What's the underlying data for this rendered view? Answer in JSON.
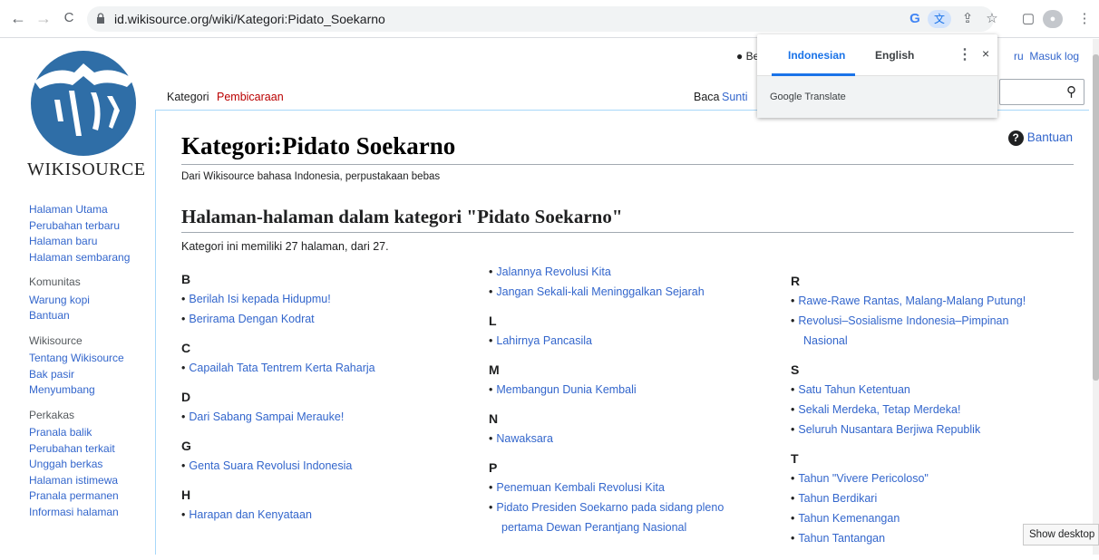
{
  "browser": {
    "url": "id.wikisource.org/wiki/Kategori:Pidato_Soekarno",
    "back_icon": "←",
    "forward_icon": "→",
    "reload_icon": "C",
    "google_icon": "G",
    "translate_icon": "文",
    "share_icon": "⇪",
    "star_icon": "☆",
    "sidepanel_icon": "▢",
    "profile_icon": "●",
    "menu_icon": "⋮"
  },
  "translate_popup": {
    "lang_source": "Indonesian",
    "lang_target": "English",
    "menu": "⋮",
    "close": "×",
    "brand": "Google Translate"
  },
  "site": {
    "wordmark": "WIKISOURCE"
  },
  "sidebar": {
    "main": [
      "Halaman Utama",
      "Perubahan terbaru",
      "Halaman baru",
      "Halaman sembarang"
    ],
    "komunitas_heading": "Komunitas",
    "komunitas": [
      "Warung kopi",
      "Bantuan"
    ],
    "wikisource_heading": "Wikisource",
    "wikisource": [
      "Tentang Wikisource",
      "Bak pasir",
      "Menyumbang"
    ],
    "perkakas_heading": "Perkakas",
    "perkakas": [
      "Pranala balik",
      "Perubahan terkait",
      "Unggah berkas",
      "Halaman istimewa",
      "Pranala permanen",
      "Informasi halaman"
    ]
  },
  "tabs": {
    "kategori": "Kategori",
    "pembicaraan": "Pembicaraan",
    "baca": "Baca",
    "sunting": "Sunti"
  },
  "personal": {
    "user_partial": "Be",
    "baru_partial": "ru",
    "masuk": "Masuk log"
  },
  "search_icon": "⚲",
  "page": {
    "title": "Kategori:Pidato Soekarno",
    "help": "Bantuan",
    "help_icon": "?",
    "subtitle": "Dari Wikisource bahasa Indonesia, perpustakaan bebas",
    "category_heading": "Halaman-halaman dalam kategori \"Pidato Soekarno\"",
    "count": "Kategori ini memiliki 27 halaman, dari 27."
  },
  "columns": [
    [
      {
        "letter": "B",
        "items": [
          "Berilah Isi kepada Hidupmu!",
          "Berirama Dengan Kodrat"
        ]
      },
      {
        "letter": "C",
        "items": [
          "Capailah Tata Tentrem Kerta Raharja"
        ]
      },
      {
        "letter": "D",
        "items": [
          "Dari Sabang Sampai Merauke!"
        ]
      },
      {
        "letter": "G",
        "items": [
          "Genta Suara Revolusi Indonesia"
        ]
      },
      {
        "letter": "H",
        "items": [
          "Harapan dan Kenyataan"
        ]
      }
    ],
    [
      {
        "letter": "",
        "items": [
          "Jalannya Revolusi Kita",
          "Jangan Sekali-kali Meninggalkan Sejarah"
        ]
      },
      {
        "letter": "L",
        "items": [
          "Lahirnya Pancasila"
        ]
      },
      {
        "letter": "M",
        "items": [
          "Membangun Dunia Kembali"
        ]
      },
      {
        "letter": "N",
        "items": [
          "Nawaksara"
        ]
      },
      {
        "letter": "P",
        "items": [
          "Penemuan Kembali Revolusi Kita",
          "Pidato Presiden Soekarno pada sidang pleno",
          "pertama Dewan Perantjang Nasional"
        ]
      }
    ],
    [
      {
        "letter": "R",
        "items": [
          "Rawe-Rawe Rantas, Malang-Malang Putung!",
          "Revolusi–Sosialisme Indonesia–Pimpinan",
          "Nasional"
        ]
      },
      {
        "letter": "S",
        "items": [
          "Satu Tahun Ketentuan",
          "Sekali Merdeka, Tetap Merdeka!",
          "Seluruh Nusantara Berjiwa Republik"
        ]
      },
      {
        "letter": "T",
        "items": [
          "Tahun \"Vivere Pericoloso\"",
          "Tahun Berdikari",
          "Tahun Kemenangan",
          "Tahun Tantangan"
        ]
      }
    ]
  ],
  "tooltip": "Show desktop",
  "colors": {
    "link": "#3366cc",
    "red_link": "#ba0000",
    "accent": "#1a73e8"
  }
}
